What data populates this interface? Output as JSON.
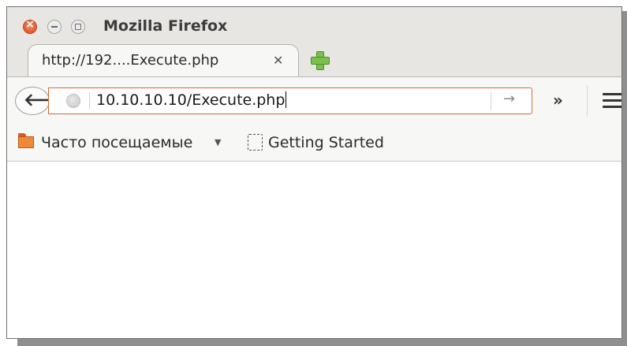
{
  "window": {
    "title": "Mozilla Firefox"
  },
  "tabs": [
    {
      "label": "http://192....Execute.php",
      "close_icon": "close-tab-icon"
    }
  ],
  "navbar": {
    "url": "10.10.10.10/Execute.php",
    "back_icon": "back-arrow-icon",
    "go_icon": "go-arrow-icon",
    "overflow_icon": "chevron-double-right-icon",
    "menu_icon": "hamburger-menu-icon"
  },
  "bookmarks": [
    {
      "label": "Часто посещаемые",
      "icon": "folder-icon"
    },
    {
      "label": "Getting Started",
      "icon": "page-icon"
    }
  ],
  "colors": {
    "accent": "#d66a2a",
    "close_button": "#e25a2f",
    "new_tab": "#7bc04a"
  }
}
